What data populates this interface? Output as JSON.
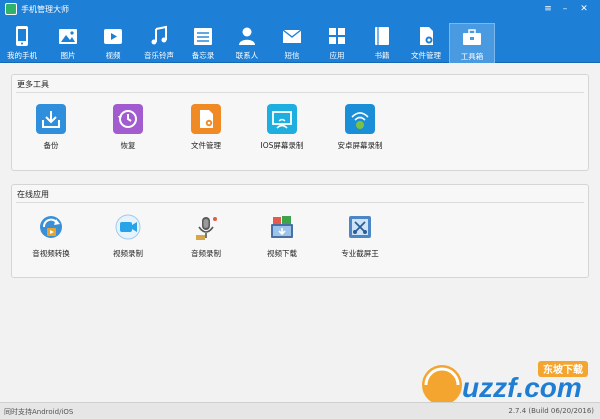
{
  "window": {
    "title": "手机管理大师"
  },
  "toolbar": {
    "tabs": [
      {
        "label": "我的手机",
        "icon": "phone-icon"
      },
      {
        "label": "图片",
        "icon": "picture-icon"
      },
      {
        "label": "视频",
        "icon": "video-icon"
      },
      {
        "label": "音乐铃声",
        "icon": "music-icon"
      },
      {
        "label": "备忘录",
        "icon": "memo-icon"
      },
      {
        "label": "联系人",
        "icon": "contacts-icon"
      },
      {
        "label": "短信",
        "icon": "sms-icon"
      },
      {
        "label": "应用",
        "icon": "apps-icon"
      },
      {
        "label": "书籍",
        "icon": "book-icon"
      },
      {
        "label": "文件管理",
        "icon": "file-manager-icon"
      },
      {
        "label": "工具箱",
        "icon": "toolbox-icon"
      }
    ],
    "active_tab": "工具箱"
  },
  "sections": {
    "more_tools": {
      "title": "更多工具",
      "items": [
        {
          "label": "备份",
          "icon": "backup-icon",
          "color": "#2f8fdc"
        },
        {
          "label": "恢复",
          "icon": "restore-icon",
          "color": "#a35ccf"
        },
        {
          "label": "文件管理",
          "icon": "file-manager-icon",
          "color": "#f08a24"
        },
        {
          "label": "IOS屏幕录制",
          "icon": "ios-screen-record-icon",
          "color": "#1eaee0"
        },
        {
          "label": "安卓屏幕录制",
          "icon": "android-screen-record-icon",
          "color": "#1a8fd8"
        }
      ]
    },
    "online_apps": {
      "title": "在线应用",
      "items": [
        {
          "label": "音视频转换",
          "icon": "av-convert-icon"
        },
        {
          "label": "视频录制",
          "icon": "video-record-icon"
        },
        {
          "label": "音频录制",
          "icon": "audio-record-icon"
        },
        {
          "label": "视频下载",
          "icon": "video-download-icon"
        },
        {
          "label": "专业截屏王",
          "icon": "screenshot-icon"
        }
      ]
    }
  },
  "statusbar": {
    "left": "同时支持Android/iOS",
    "right": "2.7.4 (Build 06/20/2016)"
  },
  "watermark": {
    "text": "uzzf.com",
    "badge": "东坡下载"
  },
  "colors": {
    "toolbar": "#1e7fd6",
    "active_tab": "#4a9ae2"
  }
}
